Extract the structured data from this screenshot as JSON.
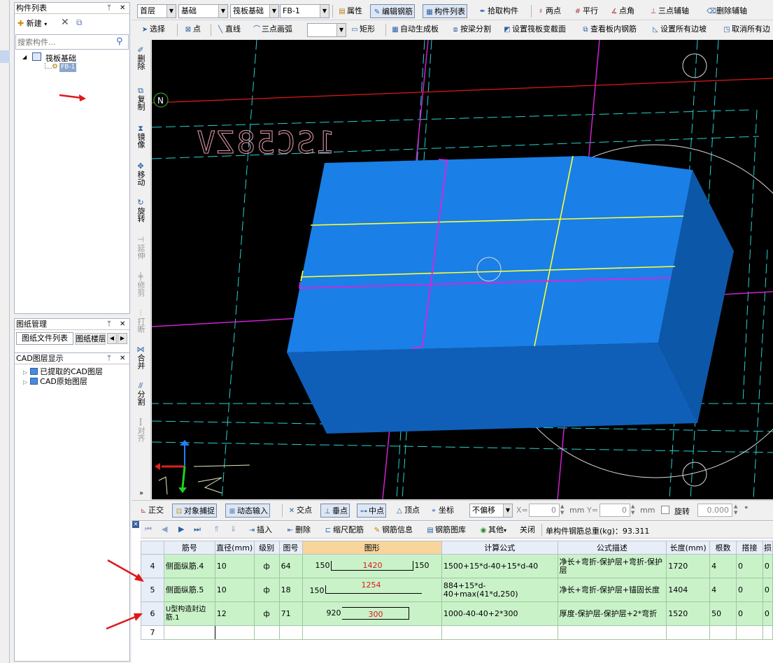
{
  "left_panel": {
    "component_list": {
      "title": "构件列表",
      "new_label": "新建",
      "search_placeholder": "搜索构件...",
      "tree_root": "筏板基础",
      "tree_child": "FB-1"
    },
    "drawing_mgmt": {
      "title": "图纸管理",
      "tab1": "图纸文件列表",
      "tab2": "图纸楼层"
    },
    "cad_layers": {
      "title": "CAD图层显示",
      "item1": "已提取的CAD图层",
      "item2": "CAD原始图层"
    }
  },
  "toolbar1": {
    "floor": "首层",
    "category": "基础",
    "type": "筏板基础",
    "component": "FB-1",
    "attr": "属性",
    "edit_rebar": "编辑钢筋",
    "comp_list": "构件列表",
    "pick": "拾取构件",
    "two_points": "两点",
    "parallel": "平行",
    "point_angle": "点角",
    "three_axis": "三点辅轴",
    "del_axis": "删除辅轴"
  },
  "toolbar2": {
    "select": "选择",
    "point": "点",
    "line": "直线",
    "arc": "三点画弧",
    "rect": "矩形",
    "auto_gen": "自动生成板",
    "split_beam": "按梁分割",
    "set_section": "设置筏板变截面",
    "view_rebar": "查看板内钢筋",
    "set_slopes": "设置所有边坡",
    "cancel_all": "取消所有边"
  },
  "side_tools": [
    "删除",
    "复制",
    "镜像",
    "移动",
    "旋转",
    "延伸",
    "修剪",
    "打断",
    "合并",
    "分割",
    "对齐"
  ],
  "viewport": {
    "compass": "N",
    "cad_text": "1SC58ZV"
  },
  "status_bar": {
    "ortho": "正交",
    "snap": "对象捕捉",
    "dyn_input": "动态输入",
    "intersection": "交点",
    "perp": "垂点",
    "midpoint": "中点",
    "vertex": "顶点",
    "coord": "坐标",
    "offset": "不偏移",
    "x_label": "X=",
    "x_value": "0",
    "mm1": "mm",
    "y_label": "Y=",
    "y_value": "0",
    "mm2": "mm",
    "rotate": "旋转",
    "rotate_value": "0.000",
    "degree": "°"
  },
  "rebar_toolbar": {
    "insert": "插入",
    "delete": "删除",
    "scale": "缩尺配筋",
    "info": "钢筋信息",
    "library": "钢筋图库",
    "other": "其他",
    "close": "关闭",
    "total": "单构件钢筋总重(kg)：93.311"
  },
  "table": {
    "headers": [
      "筋号",
      "直径(mm)",
      "级别",
      "图号",
      "图形",
      "计算公式",
      "公式描述",
      "长度(mm)",
      "根数",
      "搭接",
      "损"
    ],
    "rows": [
      {
        "n": "4",
        "name": "侧面纵筋.4",
        "dia": "10",
        "grade": "ф",
        "fig": "64",
        "s_left": "150",
        "s_mid": "1420",
        "s_right": "150",
        "formula": "1500+15*d-40+15*d-40",
        "desc": "净长+弯折-保护层+弯折-保护层",
        "len": "1720",
        "cnt": "4",
        "lap": "0",
        "loss": "0"
      },
      {
        "n": "5",
        "name": "侧面纵筋.5",
        "dia": "10",
        "grade": "ф",
        "fig": "18",
        "s_left": "150",
        "s_mid": "1254",
        "s_right": "",
        "formula": "884+15*d-40+max(41*d,250)",
        "desc": "净长+弯折-保护层+锚固长度",
        "len": "1404",
        "cnt": "4",
        "lap": "0",
        "loss": "0"
      },
      {
        "n": "6",
        "name": "U型构造封边筋.1",
        "dia": "12",
        "grade": "ф",
        "fig": "71",
        "s_left": "920",
        "s_mid": "300",
        "s_right": "",
        "formula": "1000-40-40+2*300",
        "desc": "厚度-保护层-保护层+2*弯折",
        "len": "1520",
        "cnt": "50",
        "lap": "0",
        "loss": "0"
      },
      {
        "n": "7",
        "name": "",
        "dia": "",
        "grade": "",
        "fig": "",
        "s_left": "",
        "s_mid": "",
        "s_right": "",
        "formula": "",
        "desc": "",
        "len": "",
        "cnt": "",
        "lap": "",
        "loss": ""
      }
    ]
  },
  "colors": {
    "slab_top": "#1a7fe6",
    "slab_side": "#0f5fb8",
    "rebar_yellow": "#ffff33",
    "rebar_magenta": "#e020e0",
    "grid_row": "#c9f2c9"
  }
}
